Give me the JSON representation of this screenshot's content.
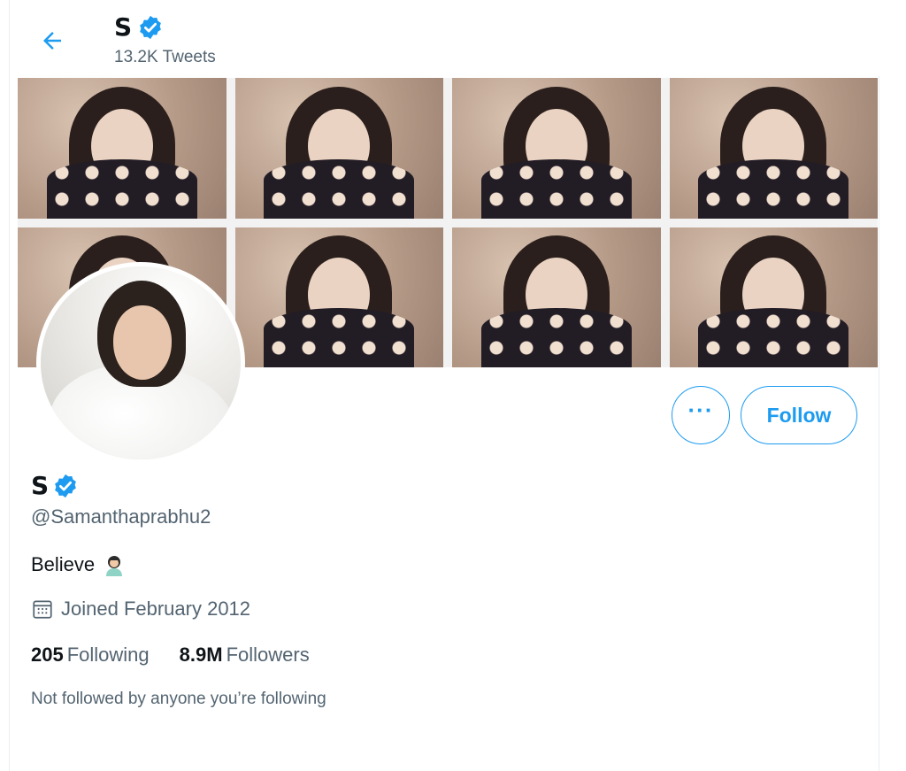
{
  "header": {
    "title": "S",
    "tweet_count": "13.2K Tweets"
  },
  "profile": {
    "name": "S",
    "handle": "@Samanthaprabhu2",
    "bio": "Believe",
    "joined": "Joined February 2012",
    "following_count": "205",
    "following_label": "Following",
    "followers_count": "8.9M",
    "followers_label": "Followers",
    "not_followed_note": "Not followed by anyone you’re following"
  },
  "actions": {
    "more_label": "···",
    "follow_label": "Follow"
  },
  "colors": {
    "accent": "#1d9bf0",
    "text_primary": "#0f1419",
    "text_secondary": "#536471"
  },
  "icons": {
    "back": "arrow-left-icon",
    "verified": "verified-badge-icon",
    "calendar": "calendar-icon",
    "bio_emoji": "person-emoji-icon"
  }
}
